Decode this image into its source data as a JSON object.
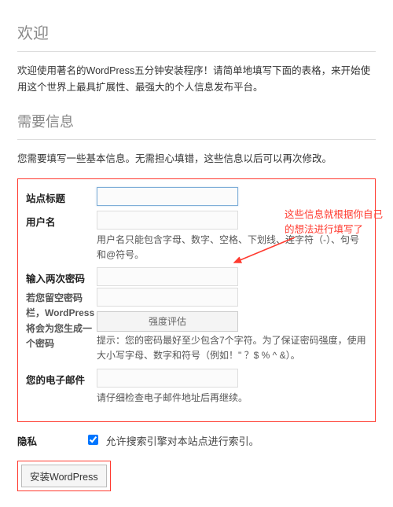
{
  "header": {
    "title": "欢迎",
    "intro": "欢迎使用著名的WordPress五分钟安装程序！请简单地填写下面的表格，来开始使用这个世界上最具扩展性、最强大的个人信息发布平台。"
  },
  "section": {
    "title": "需要信息",
    "desc": "您需要填写一些基本信息。无需担心填错，这些信息以后可以再次修改。"
  },
  "form": {
    "site_title": {
      "label": "站点标题",
      "value": ""
    },
    "username": {
      "label": "用户名",
      "value": "",
      "hint": "用户名只能包含字母、数字、空格、下划线、连字符（-）、句号和@符号。"
    },
    "password": {
      "label": "输入两次密码",
      "subnote": "若您留空密码栏，WordPress将会为您生成一个密码",
      "strength": "强度评估",
      "hint": "提示：您的密码最好至少包含7个字符。为了保证密码强度，使用大小写字母、数字和符号（例如！\" ？$ % ^ &）。"
    },
    "email": {
      "label": "您的电子邮件",
      "value": "",
      "hint": "请仔细检查电子邮件地址后再继续。"
    },
    "privacy": {
      "label": "隐私",
      "text": "允许搜索引擎对本站点进行索引。"
    },
    "submit_label": "安装WordPress"
  },
  "annotation": {
    "text": "这些信息就根据你自己的想法进行填写了",
    "color": "#ff3a2f"
  }
}
